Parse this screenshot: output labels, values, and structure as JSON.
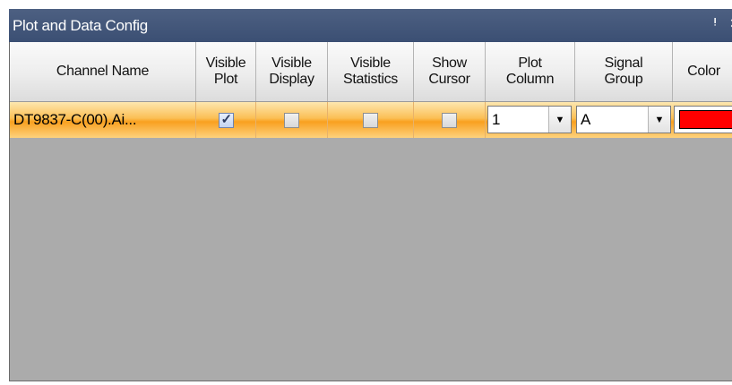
{
  "panel": {
    "title": "Plot and Data Config",
    "pin_glyph": "Ѩ",
    "close_glyph": "×"
  },
  "grid": {
    "columns": [
      {
        "label": "Channel Name"
      },
      {
        "label": "Visible\nPlot"
      },
      {
        "label": "Visible\nDisplay"
      },
      {
        "label": "Visible\nStatistics"
      },
      {
        "label": "Show\nCursor"
      },
      {
        "label": "Plot\nColumn"
      },
      {
        "label": "Signal\nGroup"
      },
      {
        "label": "Color"
      }
    ],
    "rows": [
      {
        "channel_name": "DT9837-C(00).Ai...",
        "visible_plot": true,
        "visible_display": false,
        "visible_statistics": false,
        "show_cursor": false,
        "plot_column": "1",
        "signal_group": "A",
        "color": "#ff0000"
      }
    ]
  },
  "colors": {
    "titlebar": "#43577b",
    "row_selected": "#fbbf55",
    "empty_area": "#ababab"
  }
}
